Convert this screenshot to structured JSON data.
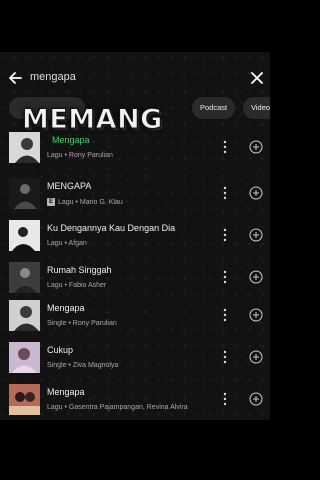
{
  "search": {
    "query": "mengapa"
  },
  "overlay_text": "MEMANG",
  "chips": [
    {
      "label": "Podcast"
    },
    {
      "label": "Video"
    }
  ],
  "results": [
    {
      "title": "Mengapa",
      "prefix": "",
      "subtitle": "Lagu • Rony Parulian",
      "active": true,
      "badge": ""
    },
    {
      "title": "MENGAPA",
      "subtitle": "Lagu • Mario G. Klau",
      "active": false,
      "badge": "E"
    },
    {
      "title": "Ku Dengannya Kau Dengan Dia",
      "subtitle": "Lagu • Afgan",
      "active": false,
      "badge": ""
    },
    {
      "title": "Rumah Singgah",
      "subtitle": "Lagu • Fabio Asher",
      "active": false,
      "badge": ""
    },
    {
      "title": "Mengapa",
      "subtitle": "Single • Rony Parulian",
      "active": false,
      "badge": ""
    },
    {
      "title": "Cukup",
      "subtitle": "Single • Ziva Magnolya",
      "active": false,
      "badge": ""
    },
    {
      "title": "Mengapa",
      "subtitle": "Lagu • Gasentra Pajampangan, Revina Alvira",
      "active": false,
      "badge": ""
    }
  ],
  "colors": {
    "accent": "#3bd16f",
    "background": "#121212",
    "chip": "#2a2a2a"
  },
  "icons": [
    "back-arrow-icon",
    "close-icon",
    "more-options-icon",
    "add-circle-icon"
  ]
}
